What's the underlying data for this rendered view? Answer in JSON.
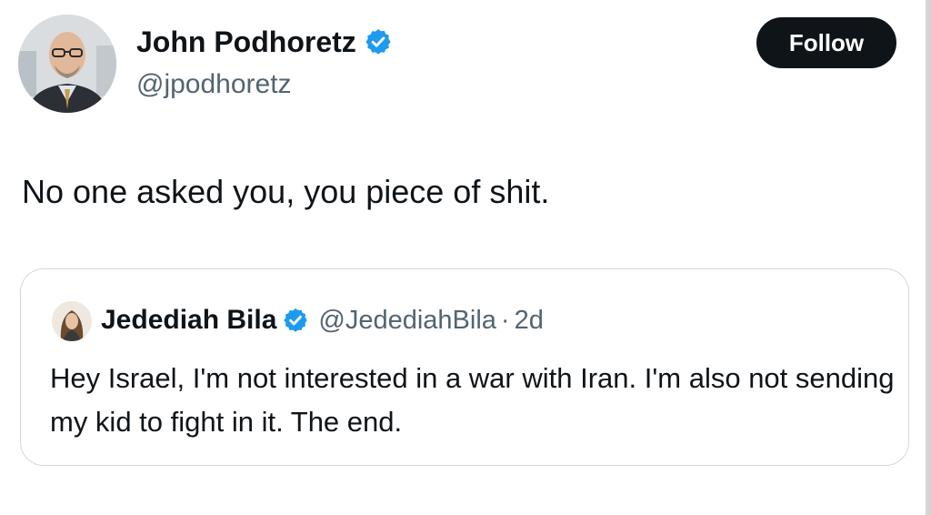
{
  "tweet": {
    "author_name": "John Podhoretz",
    "author_handle": "@jpodhoretz",
    "follow_label": "Follow",
    "text": "No one asked you, you piece of shit."
  },
  "quoted_tweet": {
    "author_name": "Jedediah Bila",
    "author_handle": "@JedediahBila",
    "separator": "·",
    "time": "2d",
    "text": "Hey Israel, I'm not interested in a war with Iran. I'm also not sending my kid to fight in it. The end."
  },
  "icons": {
    "verified": "verified-badge-icon"
  },
  "colors": {
    "verified_blue": "#1d9bf0",
    "text_primary": "#0f1419",
    "text_secondary": "#536471",
    "follow_bg": "#0f1419",
    "border": "#cfd9de"
  }
}
